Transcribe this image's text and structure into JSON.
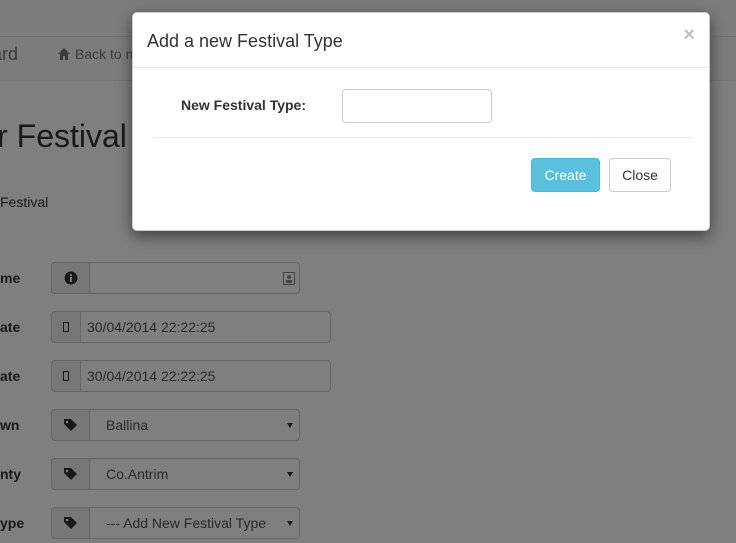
{
  "background": {
    "brand_fragment": "ard",
    "back_link_label": "Back to n",
    "heading_fragment": "ir Festival",
    "subtext_fragment": "Festival",
    "rows": [
      {
        "label": "me",
        "value": ""
      },
      {
        "label": "ate",
        "value": "30/04/2014 22:22:25"
      },
      {
        "label": "ate",
        "value": "30/04/2014 22:22:25"
      },
      {
        "label": "wn",
        "value": "Ballina"
      },
      {
        "label": "nty",
        "value": "Co.Antrim"
      },
      {
        "label": "ype",
        "value": "--- Add New Festival Type"
      }
    ]
  },
  "modal": {
    "title": "Add a new Festival Type",
    "close_symbol": "×",
    "field_label": "New Festival Type:",
    "field_value": "",
    "create_label": "Create",
    "close_label": "Close"
  },
  "colors": {
    "create_button": "#5bc0de",
    "backdrop": "rgba(0,0,0,0.5)"
  }
}
